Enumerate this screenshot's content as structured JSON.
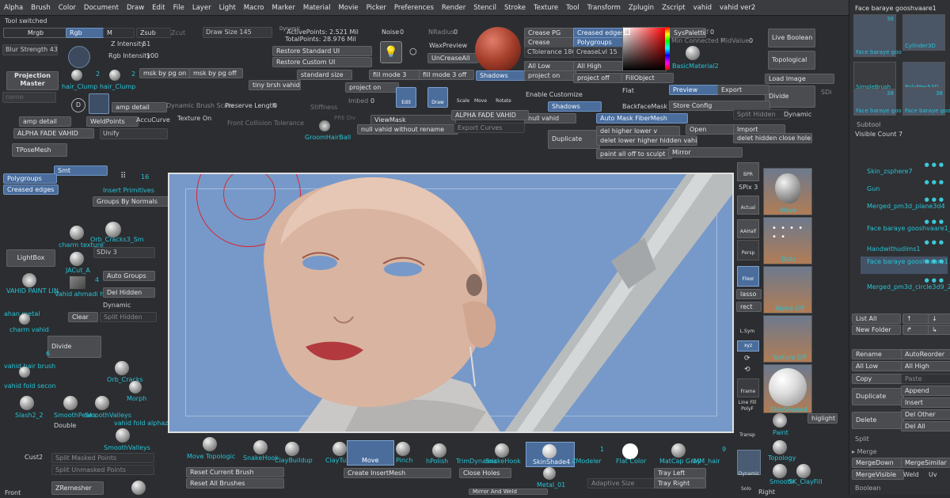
{
  "menubar": {
    "items": [
      "Alpha",
      "Brush",
      "Color",
      "Document",
      "Draw",
      "Edit",
      "File",
      "Layer",
      "Light",
      "Macro",
      "Marker",
      "Material",
      "Movie",
      "Picker",
      "Preferences",
      "Render",
      "Stencil",
      "Stroke",
      "Texture",
      "Tool",
      "Transform",
      "Zplugin",
      "Zscript",
      "vahid",
      "vahid ver2"
    ],
    "doc_title": "50"
  },
  "left": {
    "tool_switched": "Tool switched",
    "mrgb": "Mrgb",
    "rgb": "Rgb",
    "m": "M",
    "zsub": "Zsub",
    "zcut": "Zcut",
    "z_intensity": "Z Intensity",
    "z_intensity_val": "51",
    "rgb_intensity": "Rgb Intensity",
    "rgb_intensity_val": "100",
    "blur_strength": "Blur Strength",
    "blur_val": "43",
    "projection_master": "Projection Master",
    "hair_clump1": "hair_Clump",
    "hair_clump1_num": "2",
    "hair_clump2": "hair_Clump",
    "hair_clump2_num": "2",
    "msk_on": "msk by pg on",
    "msk_off": "msk by pg off",
    "name_input": "name",
    "amp_detail": "amp detail",
    "amp_detail2": "amp detail",
    "weldpoints": "WeldPoints",
    "accucurve": "AccuCurve",
    "alpha_fade": "ALPHA FADE VAHID",
    "unify": "Unify",
    "tpose": "TPoseMesh",
    "smt": "Smt",
    "polygroups": "Polygroups",
    "creased_edges": "Creased edges",
    "insert_primitives": "Insert Primitives",
    "ip_num": "16",
    "groups_by_normals": "Groups By Normals",
    "charm_texture": "charm texture",
    "orb_cracks3": "Orb_Cracks3_Sm",
    "sdiv": "SDiv",
    "sdiv_val": "3",
    "lightbox": "LightBox",
    "jacut": "JACut_A",
    "auto_groups": "Auto Groups",
    "vahid_paint": "VAHID PAINT LIN",
    "vahid_ahmadi": "Vahid ahmadi ha",
    "num4": "4",
    "del_hidden": "Del Hidden",
    "dynamic": "Dynamic",
    "ahan_metal": "ahan metal",
    "charm_vahid": "charm vahid",
    "clear": "Clear",
    "split_hidden": "Split Hidden",
    "divide": "Divide",
    "num6": "6",
    "vahid_hair_brush": "vahid hair brush",
    "vahid_fold_second": "vahid fold secon",
    "orb_cracks": "Orb_Cracks",
    "morph": "Morph",
    "slash2": "Slash2_2",
    "smoothpeaks": "SmoothPeaks",
    "smoothvalleys": "SmoothValleys",
    "vahid_fold_alpha": "vahid fold alphaz",
    "double": "Double",
    "smoothvalleys2": "SmoothValleys",
    "cust2": "Cust2",
    "split_masked": "Split Masked Points",
    "split_unmasked": "Split Unmasked Points",
    "front": "Front",
    "zremesher": "ZRemesher"
  },
  "top": {
    "draw_size": "Draw Size",
    "draw_size_val": "145",
    "dynamic_label": "Dynamic",
    "active_points": "ActivePoints: 2.521 Mil",
    "total_points": "TotalPoints: 28.976 Mil",
    "restore_standard": "Restore Standard UI",
    "restore_custom": "Restore Custom UI",
    "standard_size": "standard size",
    "tiny_brush": "tiny brsh vahid",
    "noise": "Noise",
    "noise_val": "0",
    "nradius": "NRadius",
    "nradius_val": "0",
    "waxpreview": "WaxPreview",
    "uncreaseall": "UnCreaseAll",
    "fill_mode3": "fill mode 3",
    "fill_mode3_off": "fill mode 3 off",
    "project_on": "project on",
    "imbed": "Imbed",
    "imbed_val": "0",
    "shadows_btn": "Shadows",
    "crease_pg": "Crease PG",
    "crease": "Crease",
    "ctolerance": "CTolerance",
    "ctolerance_val": "180",
    "creaselvl": "CreaseLvl",
    "creaselvl_val": "15",
    "all_low": "All Low",
    "project_on2": "project on",
    "creased_edges": "Creased edges",
    "polygroups": "Polygroups",
    "all_high": "All High",
    "project_off": "project off",
    "syspalette": "SysPalette",
    "rf": "Rf",
    "rf_val": "0",
    "min_connected": "Min Connected F",
    "midvalue": "MidValue",
    "midvalue_val": "0",
    "basic_material": "BasicMaterial2",
    "fillobject": "FillObject",
    "live_boolean": "Live Boolean",
    "topological": "Topological",
    "load_image": "Load Image",
    "divide": "Divide",
    "sdi": "SDi",
    "flat": "Flat",
    "preview": "Preview",
    "export": "Export",
    "backface_mask": "BackfaceMask",
    "store_config": "Store Config",
    "split_hidden": "Split Hidden",
    "dynamic2": "Dynamic",
    "enable_customize": "Enable Customize",
    "shadows2": "Shadows",
    "null_vahid": "null vahid",
    "auto_mask_fiber": "Auto Mask FiberMesh",
    "open": "Open",
    "import": "Import",
    "dynamic_brush_scale": "Dynamic Brush Scale",
    "preserve_length": "Preserve Length",
    "preserve_val": "0",
    "stiffness": "Stiffness",
    "texture_on": "Texture On",
    "front_collision": "Front Collision Tolerance",
    "viewmask": "ViewMask",
    "alpha_fade2": "ALPHA FADE VAHID",
    "null_vahid_rename": "null vahid without rename",
    "export_curves": "Export Curves",
    "groom_hairball": "GroomHairBall",
    "pre_div": "PRE Div",
    "duplicate": "Duplicate",
    "del_higher_lower": "del higher lower v",
    "delet_lower_higher": "delet lower higher hidden vahid",
    "paint_all_off": "paint all off to sculpt",
    "mirror": "Mirror",
    "delet_hidden_close": "delet hidden close holes",
    "edit": "Edit",
    "draw": "Draw",
    "move": "Move",
    "scale": "Scale",
    "rotate": "Rotate"
  },
  "right_tools": {
    "bpr": "BPR",
    "spix": "SPix",
    "spix_val": "3",
    "actual": "Actual",
    "aahalf": "AAHalf",
    "persp": "Persp",
    "floor": "Floor",
    "lasso": "lasso",
    "rect": "rect",
    "lsym": "L.Sym",
    "xyz": "xyz",
    "frame": "Frame",
    "line_fill": "Line Fill",
    "polyf": "PolyF",
    "transp": "Transp",
    "solo": "Solo",
    "dynamic": "Dynamic",
    "move": "Move",
    "dots": "Dots",
    "alpha_off": "Alpha Off",
    "texture_off": "Texture Off",
    "skinshade4": "SkinShade4",
    "paint": "Paint",
    "higlight": "higlight",
    "topology": "Topology",
    "smooth": "Smooth",
    "sk_clayfill": "SK_ClayFill",
    "right": "Right"
  },
  "bottom": {
    "move_topologic": "Move Topologic",
    "snakehook": "SnakeHook",
    "claybuildup": "ClayBuildup",
    "claytubes": "ClayTub",
    "move": "Move",
    "pinch": "Pinch",
    "hpolish": "hPolish",
    "trimdynamic": "TrimDynamic",
    "snakehook2": "SnakeHook",
    "skinshade4": "SkinShade4",
    "zmodeler": "ZModeler",
    "zm_num": "1",
    "flat_color": "Flat Color",
    "matcap_gray": "MatCap Gray",
    "im_hair": "IMM_hair",
    "num9": "9",
    "reset_brush": "Reset Current Brush",
    "reset_all": "Reset All Brushes",
    "create_insertmesh": "Create InsertMesh",
    "close_holes": "Close Holes",
    "metal01": "Metal_01",
    "adaptive_size": "Adaptive Size",
    "traj_left": "Tray Left",
    "tray_right": "Tray Right",
    "mirror_and_weld": "Mirror And Weld"
  },
  "tool_panel": {
    "title": "Face baraye gooshvaare1",
    "thumbs": [
      {
        "label": "Face baraye goo",
        "num": "38"
      },
      {
        "label": "Cylinder3D",
        "num": ""
      },
      {
        "label": "SimpleBrush",
        "num": ""
      },
      {
        "label": "PolyMesh3D",
        "num": ""
      },
      {
        "label": "girl-0011",
        "num": "24"
      },
      {
        "label": "Face baraye goo",
        "num": "38"
      },
      {
        "label": "Face baraye goo",
        "num": "38"
      }
    ],
    "subtool_header": "Subtool",
    "visible_count_label": "Visible Count",
    "visible_count": "7",
    "subtools": [
      "Skin_zsphere7",
      "Gun",
      "Merged_pm3d_plane3d4",
      "Face baraye gooshvaare1_2",
      "Handwithudims1",
      "Face baraye gooshvaare1",
      "Merged_pm3d_circle3d9_2"
    ],
    "list_all": "List All",
    "new_folder": "New Folder",
    "rename": "Rename",
    "autoreorder": "AutoReorder",
    "all_low": "All Low",
    "all_high": "All High",
    "copy": "Copy",
    "paste": "Paste",
    "duplicate": "Duplicate",
    "append": "Append",
    "insert": "Insert",
    "delete": "Delete",
    "del_other": "Del Other",
    "del_all": "Del All",
    "split": "Split",
    "merge": "Merge",
    "mergedown": "MergeDown",
    "mergesimilar": "MergeSimilar",
    "mergevisible": "MergeVisible",
    "weld": "Weld",
    "uv": "Uv",
    "boolean": "Boolean"
  },
  "colors": {
    "accent_blue": "#4a6d9c",
    "cyan_text": "#27c3d6",
    "viewport_bg": "#7799c9",
    "panel_bg": "#2b2d30"
  }
}
